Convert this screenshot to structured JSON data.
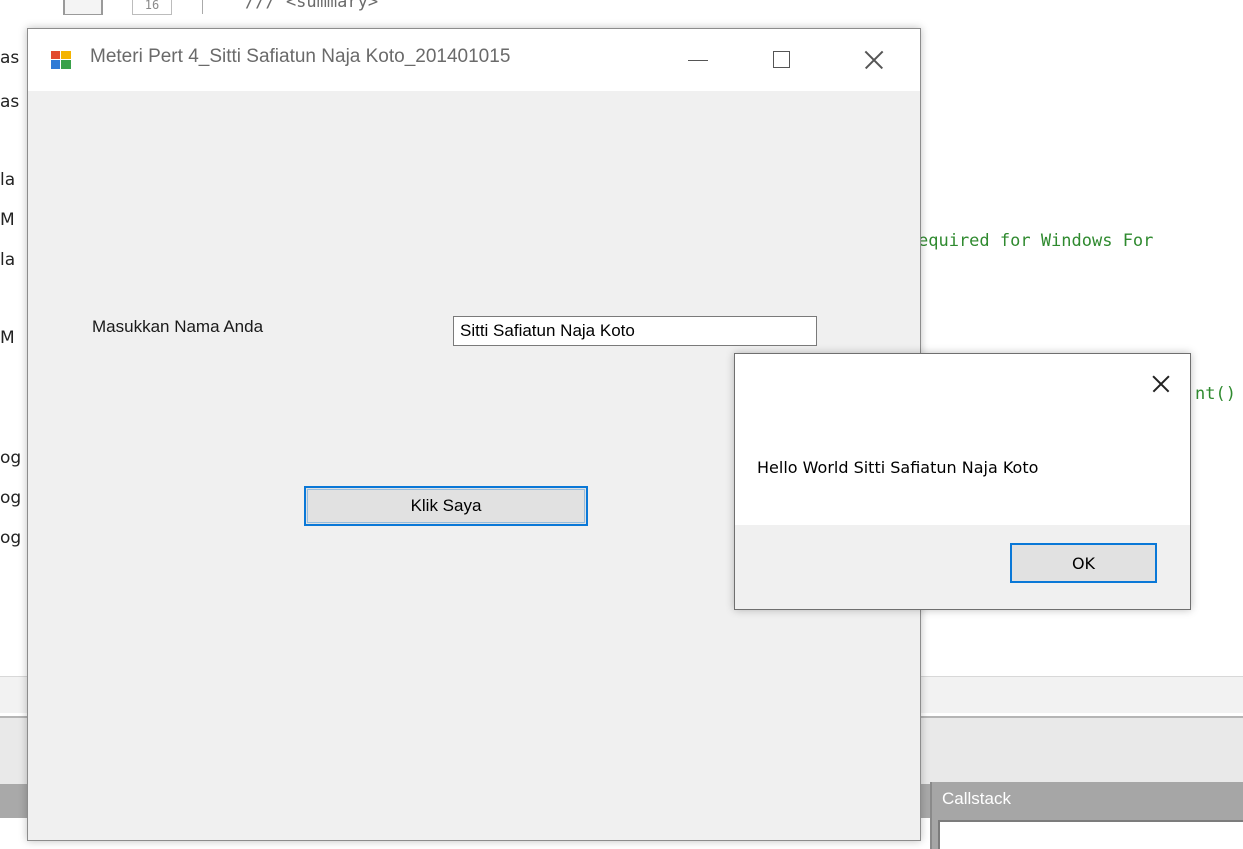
{
  "ide": {
    "left_fragments": [
      "as",
      "as",
      "la",
      "M",
      "la",
      "M",
      "og",
      "og",
      "og"
    ],
    "line_number": "16",
    "code_top": "/// <summary>",
    "code_required": "equired for Windows For",
    "code_init": "nt()",
    "callstack_title": "Callstack"
  },
  "form": {
    "title": "Meteri Pert 4_Sitti Safiatun Naja Koto_201401015",
    "label_name": "Masukkan Nama Anda",
    "input_value": "Sitti Safiatun Naja Koto",
    "button_label": "Klik Saya"
  },
  "message_box": {
    "text": "Hello World Sitti Safiatun Naja Koto",
    "ok_label": "OK"
  },
  "colors": {
    "accent": "#0a78d7",
    "window_bg": "#f0f0f0",
    "code_comment": "#2f8a2f"
  }
}
